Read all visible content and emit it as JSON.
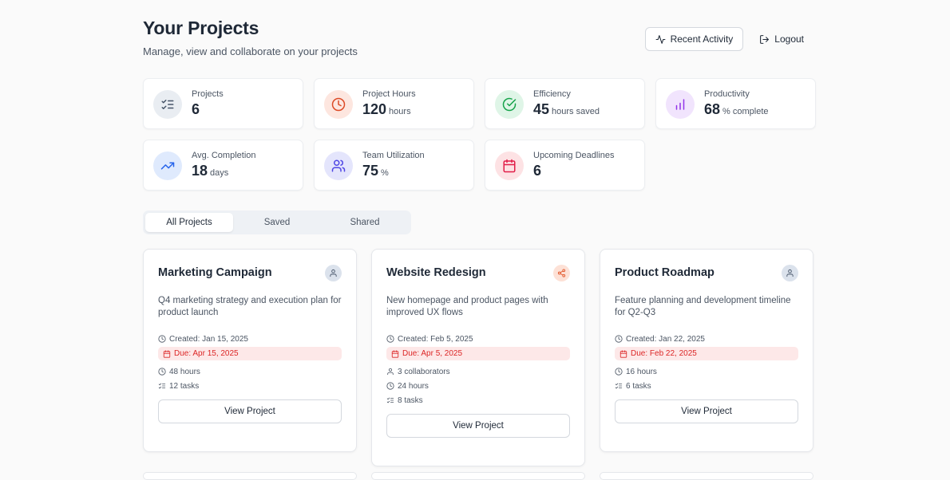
{
  "header": {
    "title": "Your Projects",
    "subtitle": "Manage, view and collaborate on your projects",
    "recent_activity_label": "Recent Activity",
    "logout_label": "Logout"
  },
  "stats": [
    {
      "label": "Projects",
      "value": "6",
      "unit": "",
      "icon": "list-checks-icon",
      "color": "#475569",
      "bg": "#e9edf2"
    },
    {
      "label": "Project Hours",
      "value": "120",
      "unit": "hours",
      "icon": "clock-icon",
      "color": "#dc4a26",
      "bg": "#fde6df"
    },
    {
      "label": "Efficiency",
      "value": "45",
      "unit": "hours saved",
      "icon": "check-circle-icon",
      "color": "#16a34a",
      "bg": "#dff5e7"
    },
    {
      "label": "Productivity",
      "value": "68",
      "unit": "% complete",
      "icon": "bar-chart-icon",
      "color": "#9333ea",
      "bg": "#f1e4fd"
    },
    {
      "label": "Avg. Completion",
      "value": "18",
      "unit": "days",
      "icon": "trending-up-icon",
      "color": "#2563eb",
      "bg": "#dfeafd"
    },
    {
      "label": "Team Utilization",
      "value": "75",
      "unit": "%",
      "icon": "users-icon",
      "color": "#4f46e5",
      "bg": "#e4e5fc"
    },
    {
      "label": "Upcoming Deadlines",
      "value": "6",
      "unit": "",
      "icon": "calendar-icon",
      "color": "#e11d48",
      "bg": "#fde2e4"
    }
  ],
  "tabs": [
    {
      "label": "All Projects",
      "active": true
    },
    {
      "label": "Saved",
      "active": false
    },
    {
      "label": "Shared",
      "active": false
    }
  ],
  "projects": [
    {
      "title": "Marketing Campaign",
      "badge_icon": "user-icon",
      "description": "Q4 marketing strategy and execution plan for product launch",
      "created": "Created: Jan 15, 2025",
      "due": "Due: Apr 15, 2025",
      "collaborators": "",
      "hours": "48 hours",
      "tasks": "12 tasks",
      "button": "View Project"
    },
    {
      "title": "Website Redesign",
      "badge_icon": "share-icon",
      "description": "New homepage and product pages with improved UX flows",
      "created": "Created: Feb 5, 2025",
      "due": "Due: Apr 5, 2025",
      "collaborators": "3 collaborators",
      "hours": "24 hours",
      "tasks": "8 tasks",
      "button": "View Project"
    },
    {
      "title": "Product Roadmap",
      "badge_icon": "user-icon",
      "description": "Feature planning and development timeline for Q2-Q3",
      "created": "Created: Jan 22, 2025",
      "due": "Due: Feb 22, 2025",
      "collaborators": "",
      "hours": "16 hours",
      "tasks": "6 tasks",
      "button": "View Project"
    }
  ]
}
